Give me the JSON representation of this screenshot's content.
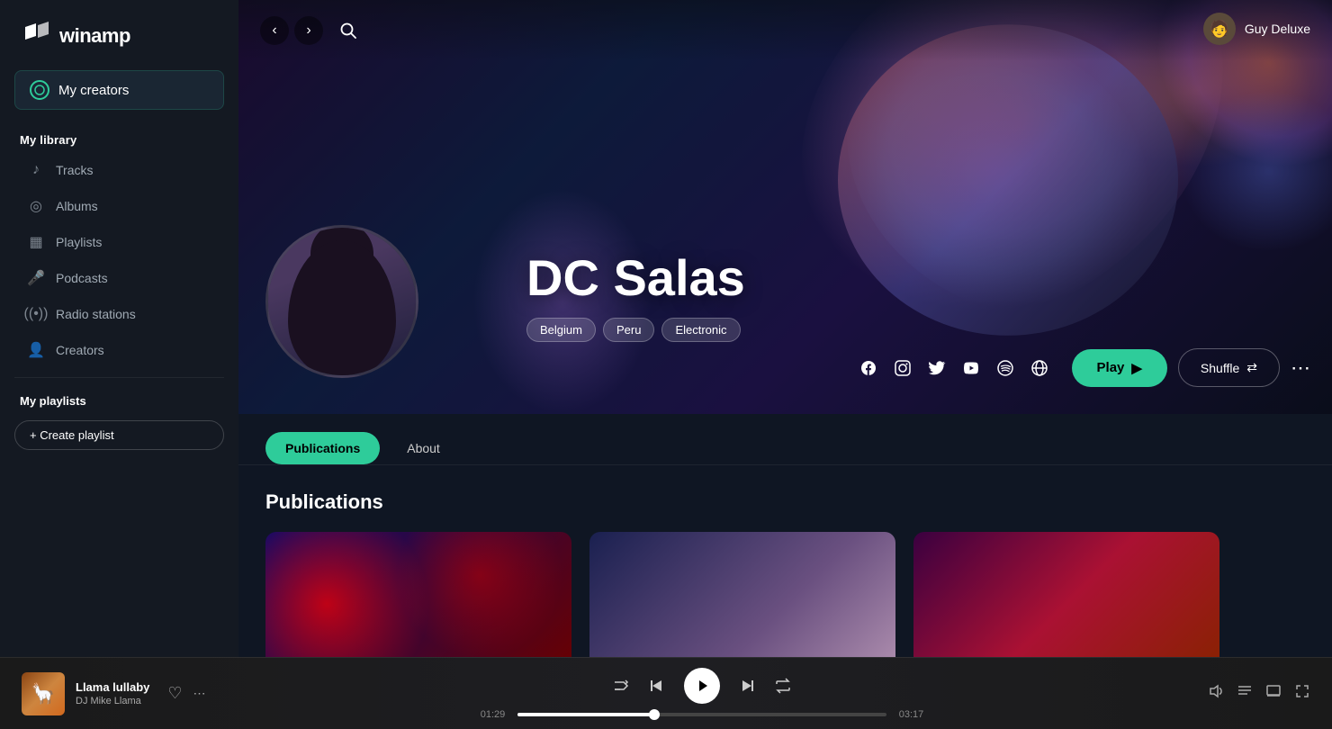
{
  "app": {
    "name": "winamp"
  },
  "sidebar": {
    "my_creators_label": "My creators",
    "my_library_label": "My library",
    "items": [
      {
        "id": "tracks",
        "label": "Tracks",
        "icon": "♪"
      },
      {
        "id": "albums",
        "label": "Albums",
        "icon": "◎"
      },
      {
        "id": "playlists",
        "label": "Playlists",
        "icon": "▦"
      },
      {
        "id": "podcasts",
        "label": "Podcasts",
        "icon": "🎤"
      },
      {
        "id": "radio",
        "label": "Radio stations",
        "icon": "((•))"
      },
      {
        "id": "creators",
        "label": "Creators",
        "icon": "👤"
      }
    ],
    "my_playlists_label": "My playlists",
    "create_playlist_label": "+ Create playlist"
  },
  "user": {
    "name": "Guy Deluxe",
    "avatar_emoji": "👤"
  },
  "artist": {
    "name": "DC Salas",
    "tags": [
      "Belgium",
      "Peru",
      "Electronic"
    ]
  },
  "playback": {
    "play_label": "Play",
    "shuffle_label": "Shuffle"
  },
  "social": {
    "icons": [
      "f",
      "◎",
      "✗",
      "▶",
      "♫",
      "🌐"
    ]
  },
  "tabs": [
    {
      "id": "publications",
      "label": "Publications",
      "active": true
    },
    {
      "id": "about",
      "label": "About",
      "active": false
    }
  ],
  "publications": {
    "title": "Publications",
    "cards": [
      {
        "id": 1,
        "style": "card-1"
      },
      {
        "id": 2,
        "style": "card-2"
      },
      {
        "id": 3,
        "style": "card-3"
      }
    ]
  },
  "player": {
    "track_name": "Llama lullaby",
    "artist_name": "DJ Mike Llama",
    "current_time": "01:29",
    "total_time": "03:17",
    "progress_pct": 37,
    "thumb_emoji": "🦙"
  }
}
